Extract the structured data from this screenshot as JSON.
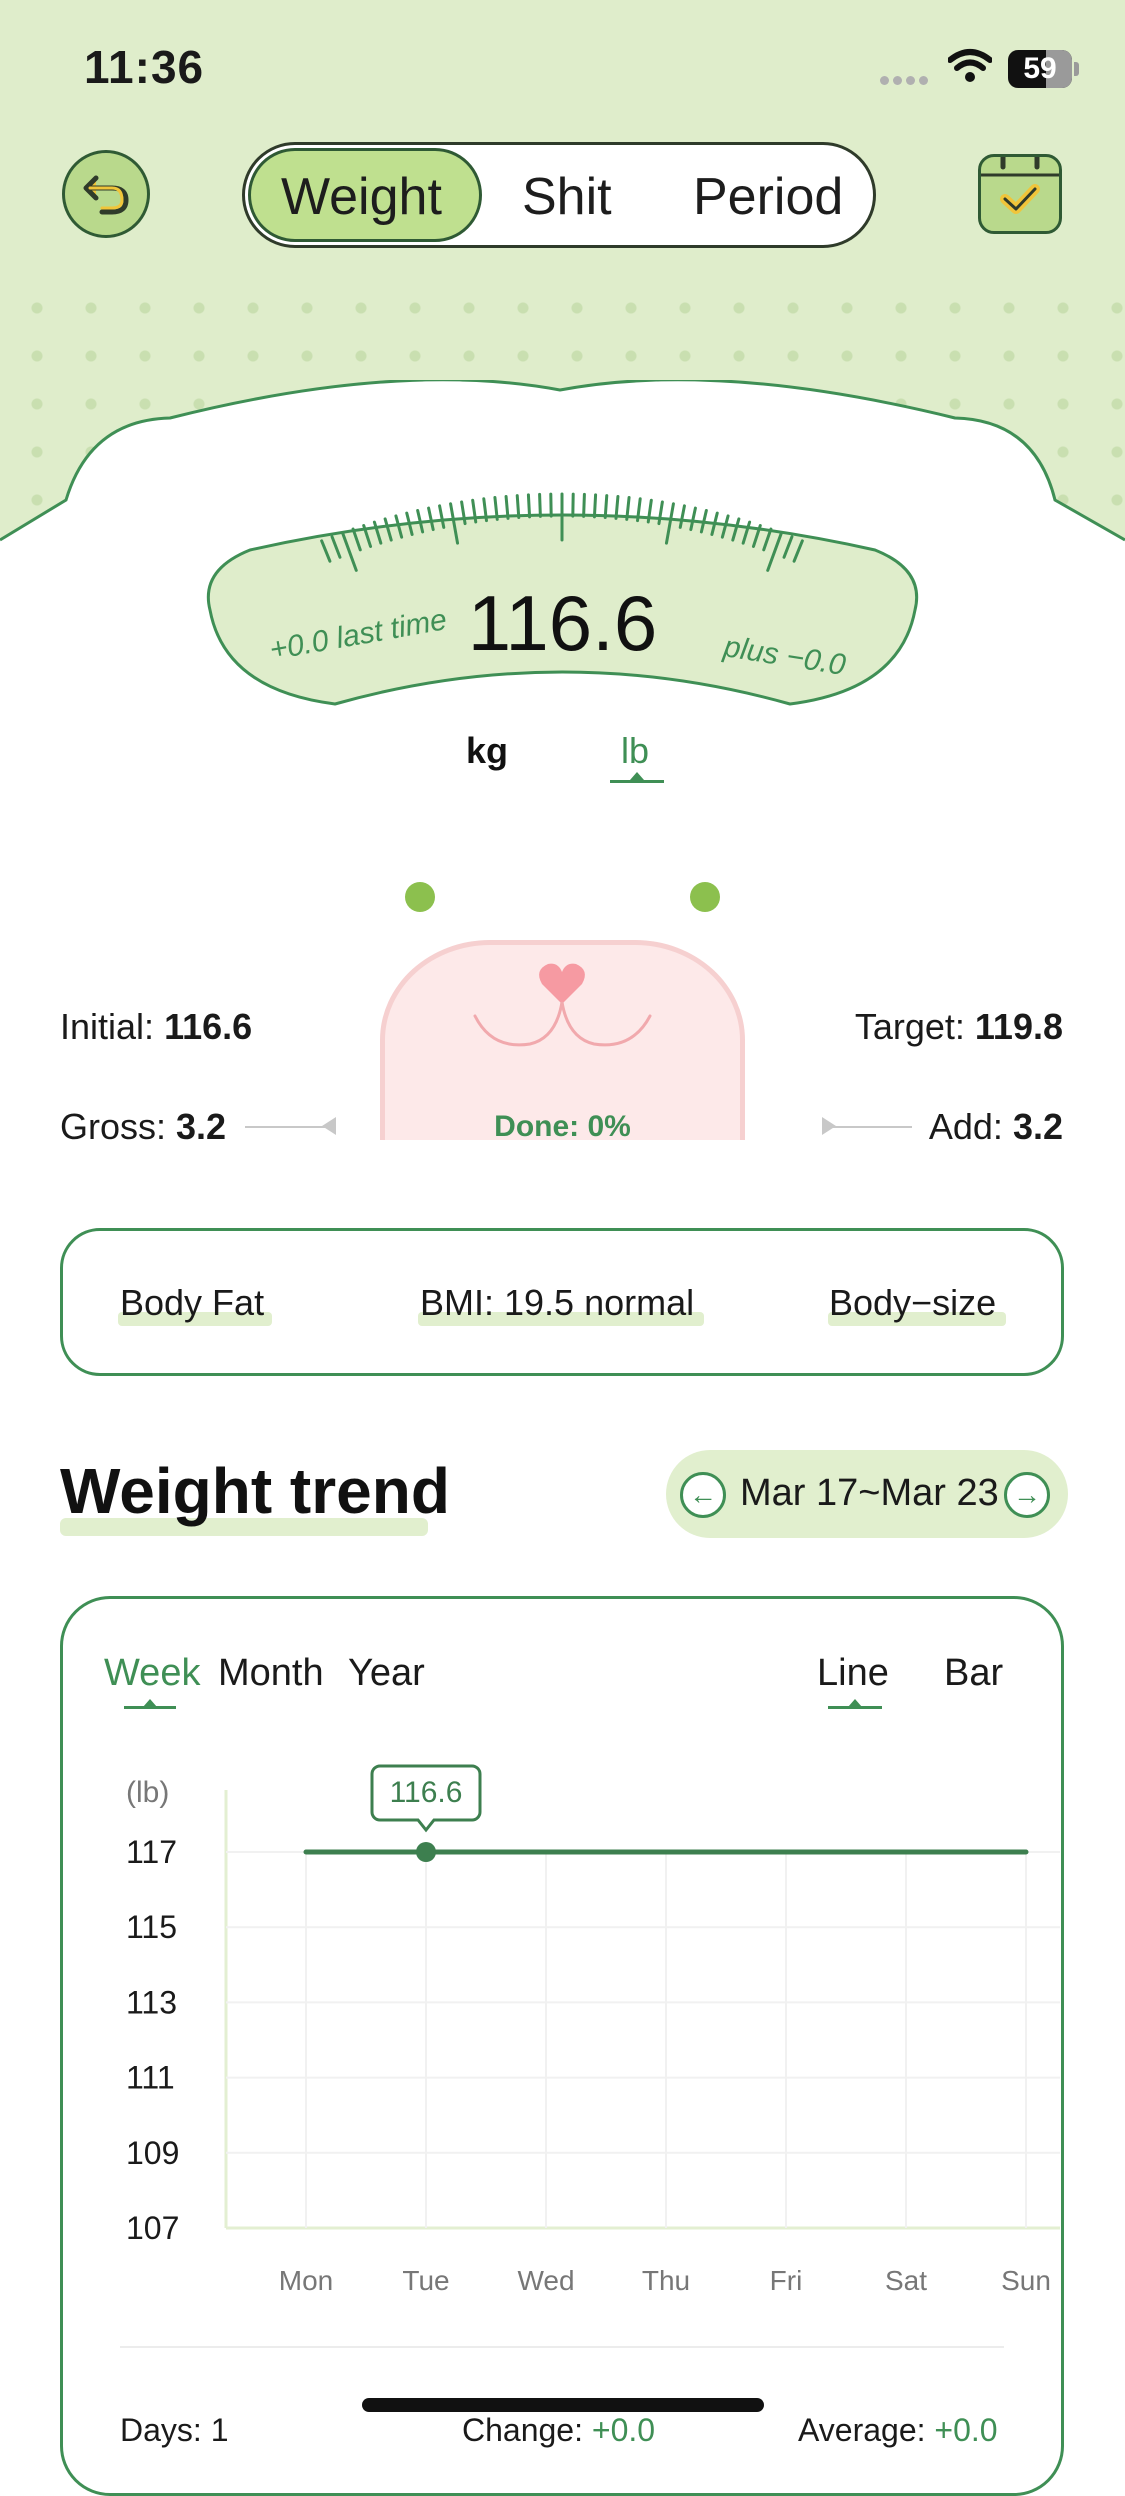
{
  "status_bar": {
    "time": "11:36",
    "battery": "59"
  },
  "header": {
    "tabs": [
      {
        "label": "Weight",
        "active": true
      },
      {
        "label": "Shit",
        "active": false
      },
      {
        "label": "Period",
        "active": false
      }
    ],
    "back_icon": "undo-arrow-icon",
    "calendar_icon": "calendar-check-icon"
  },
  "scale": {
    "value": "116.6",
    "last_time": "+0.0 last time",
    "plus": "plus −0.0",
    "units": [
      "kg",
      "lb"
    ],
    "selected_unit": "lb"
  },
  "progress": {
    "initial_label": "Initial:",
    "initial_value": "116.6",
    "target_label": "Target:",
    "target_value": "119.8",
    "gross_label": "Gross:",
    "gross_value": "3.2",
    "add_label": "Add:",
    "add_value": "3.2",
    "done": "Done: 0%"
  },
  "metrics": {
    "body_fat": "Body Fat",
    "bmi": "BMI: 19.5 normal",
    "body_size": "Body−size"
  },
  "trend": {
    "title": "Weight trend",
    "range": "Mar 17~Mar 23",
    "period_tabs": [
      "Week",
      "Month",
      "Year"
    ],
    "selected_period": "Week",
    "chart_types": [
      "Line",
      "Bar"
    ],
    "selected_chart_type": "Line"
  },
  "chart_data": {
    "type": "line",
    "ylabel": "(lb)",
    "categories": [
      "Mon",
      "Tue",
      "Wed",
      "Thu",
      "Fri",
      "Sat",
      "Sun"
    ],
    "yticks": [
      "117",
      "115",
      "113",
      "111",
      "109",
      "107"
    ],
    "ylim": [
      107,
      117
    ],
    "series": [
      {
        "values": [
          117,
          117,
          117,
          117,
          117,
          117,
          117
        ]
      }
    ],
    "highlight": {
      "category": "Tue",
      "label": "116.6"
    },
    "line_color": "#3d7f4f",
    "grid": true
  },
  "summary": {
    "days_label": "Days: 1",
    "change_label": "Change:",
    "change_value": "+0.0",
    "average_label": "Average:",
    "average_value": "+0.0"
  },
  "colors": {
    "accent": "#3f8f55",
    "top_background": "#dfedcb",
    "active_tab": "#bfe08f",
    "highlight": "#e1efce",
    "cat_face": "#fde9e9"
  }
}
